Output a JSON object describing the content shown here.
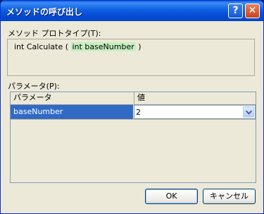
{
  "window": {
    "title": "メソッドの呼び出し",
    "help_label": "?",
    "close_label": "✕"
  },
  "prototype": {
    "label": "メソッド プロトタイプ(T):",
    "prefix": "int Calculate ( ",
    "highlight": "int baseNumber",
    "suffix": " )"
  },
  "parameters": {
    "label": "パラメータ(P):",
    "columns": [
      "パラメータ",
      "値"
    ],
    "rows": [
      {
        "name": "baseNumber",
        "value": "2"
      }
    ]
  },
  "buttons": {
    "ok": "OK",
    "cancel": "キャンセル"
  },
  "icons": {
    "help": "help-icon",
    "close": "close-icon",
    "dropdown": "chevron-down-icon"
  },
  "colors": {
    "selection": "#316ac5",
    "highlight": "#c6f0c0",
    "titlebar": "#0549d3"
  }
}
